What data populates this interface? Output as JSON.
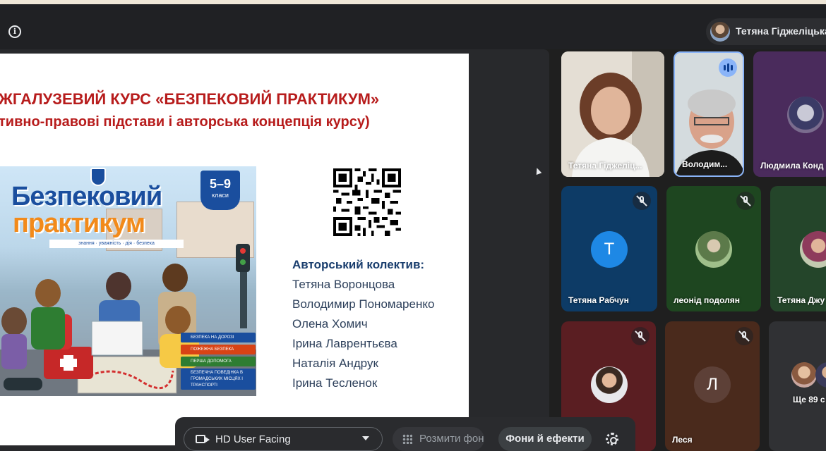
{
  "meeting": {
    "current_user": "Тетяна Гіджеліцька"
  },
  "slide": {
    "title": "ЖГАЛУЗЕВИЙ КУРС «БЕЗПЕКОВИЙ ПРАКТИКУМ»",
    "subtitle": "тивно-правові підстави і авторська концепція курсу)",
    "poster": {
      "title_line1": "Безпековий",
      "title_line2": "практикум",
      "tagline": "знання · уважність · дія · безпека",
      "grade_number": "5–9",
      "grade_word": "класи",
      "topics": [
        "БЕЗПЕКА НА ДОРОЗІ",
        "ПОЖЕЖНА БЕЗПЕКА",
        "ПЕРША ДОПОМОГА",
        "БЕЗПЕЧНА ПОВЕДІНКА В ГРОМАДСЬКИХ МІСЦЯХ І ТРАНСПОРТІ"
      ],
      "topic_colors": [
        "#1a4e9e",
        "#d84315",
        "#2e7d32",
        "#1a4e9e"
      ]
    },
    "authors_title": "Авторський колектив:",
    "authors": [
      "Тетяна Воронцова",
      "Володимир Пономаренко",
      "Олена  Хомич",
      "Ірина Лаврентьєва",
      "Наталія Андрук",
      "Ірина Тесленок"
    ]
  },
  "participants": [
    {
      "name": "Тетяна Гіджеліц...",
      "muted": false
    },
    {
      "name": "Володим...",
      "speaking": true
    },
    {
      "name": "Людмила Конд"
    },
    {
      "name": "Тетяна Рабчун",
      "initial": "Т",
      "muted": true
    },
    {
      "name": "леонід подолян",
      "muted": true
    },
    {
      "name": "Тетяна Джу"
    },
    {
      "name": "",
      "muted": true
    },
    {
      "name": "Леся",
      "initial": "Л",
      "muted": true
    },
    {
      "name": "Ще 89 с"
    }
  ],
  "controls": {
    "camera_label": "HD User Facing",
    "blur_label": "Розмити фон",
    "effects_label": "Фони й ефекти"
  },
  "colors": {
    "title_red": "#b71c1c",
    "authors_blue": "#1a3e6e",
    "meet_dark": "#202124",
    "avatar_blue": "#1e88e5",
    "avatar_brown": "#4e342e"
  }
}
